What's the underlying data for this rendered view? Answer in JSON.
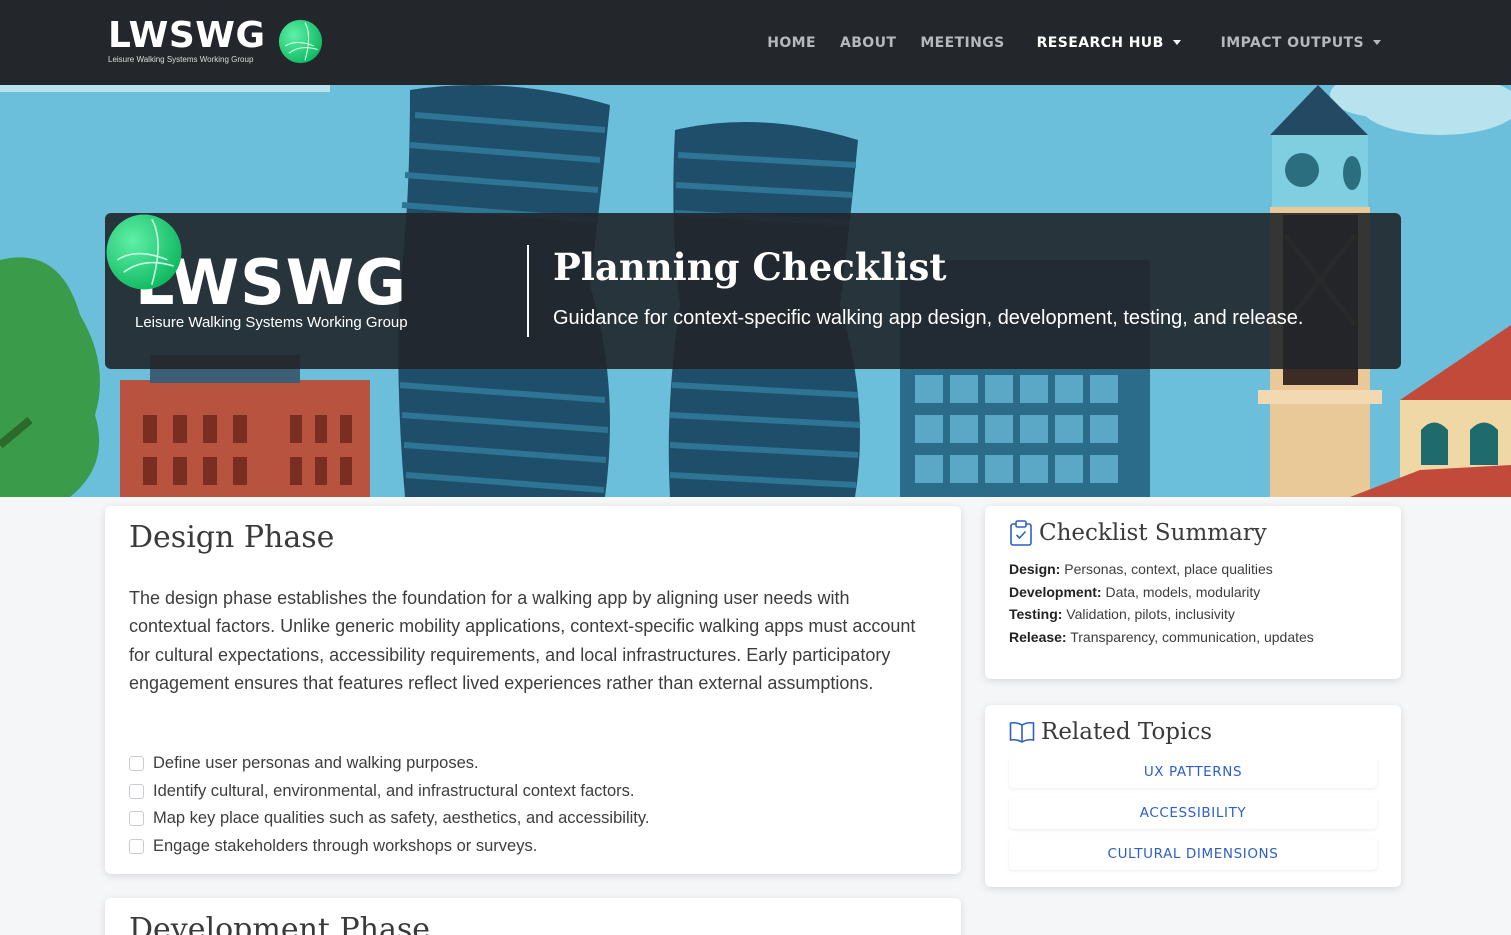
{
  "brand": {
    "name": "LWSWG",
    "tagline": "Leisure Walking Systems Working Group",
    "globe_icon": "green-globe-logo",
    "globe_color": "#1ed67a"
  },
  "nav": {
    "items": [
      {
        "label": "HOME"
      },
      {
        "label": "ABOUT"
      },
      {
        "label": "MEETINGS"
      },
      {
        "label": "RESEARCH HUB",
        "active": true,
        "dropdown": true
      },
      {
        "label": "IMPACT OUTPUTS",
        "dropdown": true
      }
    ]
  },
  "hero": {
    "logo_name": "LWSWG",
    "logo_sub": "Leisure Walking Systems Working Group",
    "title": "Planning Checklist",
    "subtitle": "Guidance for context-specific walking app design, development, testing, and release."
  },
  "design": {
    "title": "Design Phase",
    "body": "The design phase establishes the foundation for a walking app by aligning user needs with contextual factors. Unlike generic mobility applications, context-specific walking apps must account for cultural expectations, accessibility requirements, and local infrastructures. Early participatory engagement ensures that features reflect lived experiences rather than external assumptions.",
    "checklist": [
      "Define user personas and walking purposes.",
      "Identify cultural, environmental, and infrastructural context factors.",
      "Map key place qualities such as safety, aesthetics, and accessibility.",
      "Engage stakeholders through workshops or surveys."
    ]
  },
  "development": {
    "title": "Development Phase"
  },
  "summary": {
    "title": "Checklist Summary",
    "icon": "clipboard-check-icon",
    "items": [
      {
        "label": "Design:",
        "value": "Personas, context, place qualities"
      },
      {
        "label": "Development:",
        "value": "Data, models, modularity"
      },
      {
        "label": "Testing:",
        "value": "Validation, pilots, inclusivity"
      },
      {
        "label": "Release:",
        "value": "Transparency, communication, updates"
      }
    ]
  },
  "related": {
    "title": "Related Topics",
    "icon": "book-icon",
    "topics": [
      "UX PATTERNS",
      "ACCESSIBILITY",
      "CULTURAL DIMENSIONS"
    ]
  },
  "colors": {
    "navbar": "#23272b",
    "sky": "#6bbfda",
    "accent": "#2d5fc7"
  }
}
